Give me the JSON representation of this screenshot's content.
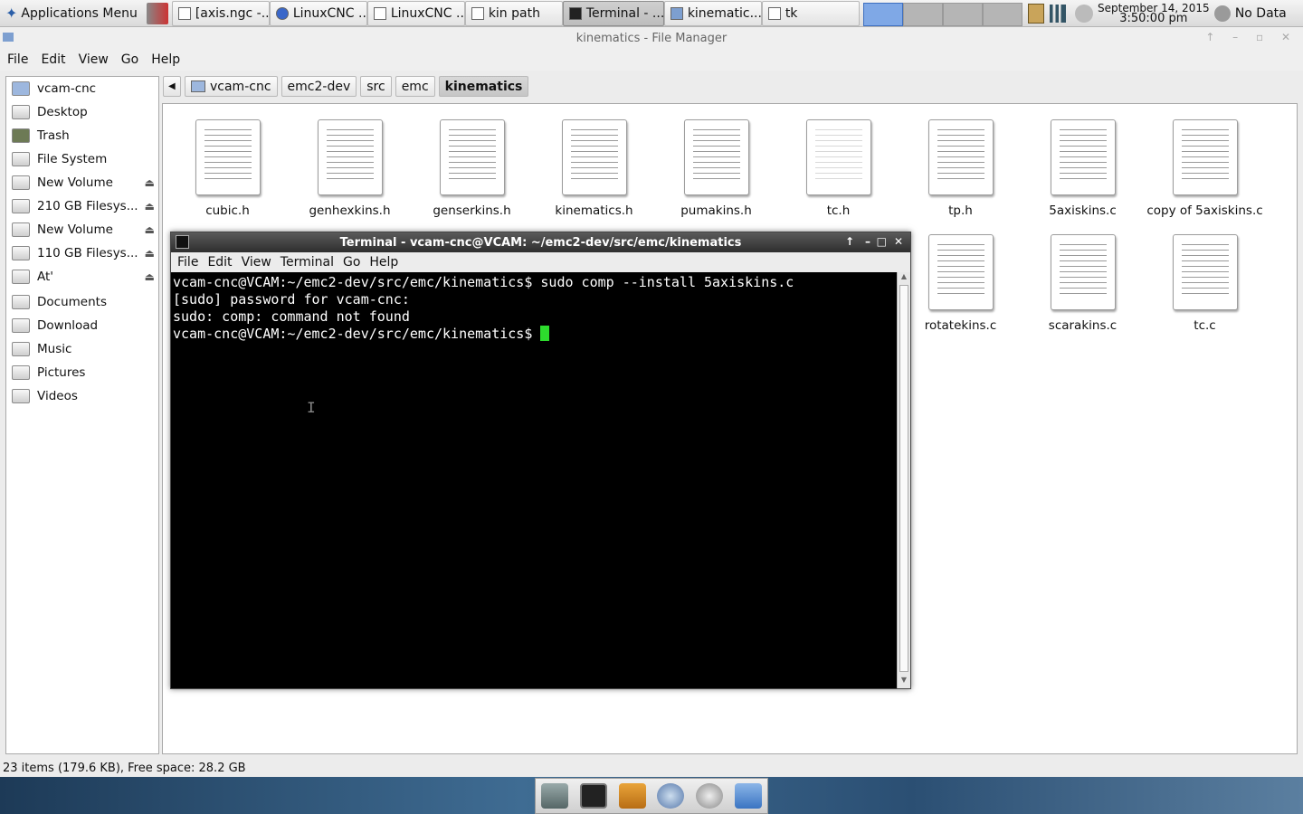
{
  "panel": {
    "app_menu": "Applications Menu",
    "tasks": [
      {
        "label": "[axis.ngc -..."
      },
      {
        "label": "LinuxCNC ..."
      },
      {
        "label": "LinuxCNC ..."
      },
      {
        "label": "kin path"
      },
      {
        "label": "Terminal - ..."
      },
      {
        "label": "kinematic..."
      },
      {
        "label": "tk"
      }
    ],
    "clock_date": "September 14, 2015",
    "clock_time": "3:50:00 pm",
    "weather": "No Data"
  },
  "file_manager": {
    "title": "kinematics - File Manager",
    "menu": [
      "File",
      "Edit",
      "View",
      "Go",
      "Help"
    ],
    "sidebar": [
      {
        "label": "vcam-cnc"
      },
      {
        "label": "Desktop"
      },
      {
        "label": "Trash"
      },
      {
        "label": "File System"
      },
      {
        "label": "New Volume"
      },
      {
        "label": "210 GB Filesys..."
      },
      {
        "label": "New Volume"
      },
      {
        "label": "110 GB Filesys..."
      },
      {
        "label": "At'"
      },
      {
        "label": "Documents"
      },
      {
        "label": "Download"
      },
      {
        "label": "Music"
      },
      {
        "label": "Pictures"
      },
      {
        "label": "Videos"
      }
    ],
    "breadcrumb": [
      "vcam-cnc",
      "emc2-dev",
      "src",
      "emc",
      "kinematics"
    ],
    "files": [
      "cubic.h",
      "genhexkins.h",
      "genserkins.h",
      "kinematics.h",
      "pumakins.h",
      "tc.h",
      "tp.h",
      "5axiskins.c",
      "copy of 5axiskins.c",
      "rotatekins.c",
      "scarakins.c",
      "tc.c"
    ],
    "status": "23 items (179.6 KB), Free space: 28.2 GB"
  },
  "terminal": {
    "title": "Terminal - vcam-cnc@VCAM: ~/emc2-dev/src/emc/kinematics",
    "menu": [
      "File",
      "Edit",
      "View",
      "Terminal",
      "Go",
      "Help"
    ],
    "lines": [
      "vcam-cnc@VCAM:~/emc2-dev/src/emc/kinematics$ sudo comp --install 5axiskins.c",
      "[sudo] password for vcam-cnc:",
      "sudo: comp: command not found",
      "vcam-cnc@VCAM:~/emc2-dev/src/emc/kinematics$ "
    ]
  }
}
